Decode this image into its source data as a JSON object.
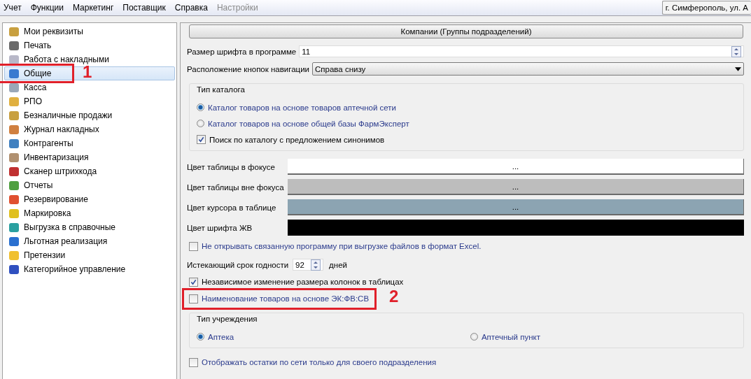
{
  "menu": [
    {
      "label": "Учет",
      "disabled": false
    },
    {
      "label": "Функции",
      "disabled": false
    },
    {
      "label": "Маркетинг",
      "disabled": false
    },
    {
      "label": "Поставщик",
      "disabled": false
    },
    {
      "label": "Справка",
      "disabled": false
    },
    {
      "label": "Настройки",
      "disabled": true
    }
  ],
  "location": {
    "value": "г. Симферополь, ул. А"
  },
  "sidebar": {
    "items": [
      {
        "label": "Мои реквизиты",
        "selected": false
      },
      {
        "label": "Печать",
        "selected": false
      },
      {
        "label": "Работа с накладными",
        "selected": false
      },
      {
        "label": "Общие",
        "selected": true,
        "callout": "1"
      },
      {
        "label": "Касса",
        "selected": false
      },
      {
        "label": "РПО",
        "selected": false
      },
      {
        "label": "Безналичные продажи",
        "selected": false
      },
      {
        "label": "Журнал накладных",
        "selected": false
      },
      {
        "label": "Контрагенты",
        "selected": false
      },
      {
        "label": "Инвентаризация",
        "selected": false
      },
      {
        "label": "Сканер штрихкода",
        "selected": false
      },
      {
        "label": "Отчеты",
        "selected": false
      },
      {
        "label": "Резервирование",
        "selected": false
      },
      {
        "label": "Маркировка",
        "selected": false
      },
      {
        "label": "Выгрузка в справочные",
        "selected": false
      },
      {
        "label": "Льготная реализация",
        "selected": false
      },
      {
        "label": "Претензии",
        "selected": false
      },
      {
        "label": "Категорийное управление",
        "selected": false
      }
    ]
  },
  "settings": [
    {
      "kind": "button",
      "label": "Компании (Группы подразделений)"
    },
    {
      "kind": "spin",
      "label": "Размер шрифта в программе",
      "value": "11"
    },
    {
      "kind": "dropdown",
      "label": "Расположение кнопок навигации",
      "value": "Справа снизу"
    },
    {
      "kind": "group",
      "title": "Тип каталога",
      "options": [
        {
          "kind": "radio",
          "label": "Каталог товаров на основе товаров аптечной сети",
          "selected": true,
          "highlighted": true
        },
        {
          "kind": "radio",
          "label": "Каталог товаров на основе общей базы ФармЭксперт",
          "selected": false,
          "highlighted": true
        },
        {
          "kind": "checkbox",
          "label": "Поиск по каталогу с предложением синонимов",
          "checked": true,
          "highlighted": false
        }
      ]
    },
    {
      "kind": "color",
      "label": "Цвет таблицы в фокусе",
      "color": "#ffffff",
      "button": "..."
    },
    {
      "kind": "color",
      "label": "Цвет таблицы вне фокуса",
      "color": "#bdbdbd",
      "button": "..."
    },
    {
      "kind": "color",
      "label": "Цвет курсора в таблице",
      "color": "#8ca4b2",
      "button": "..."
    },
    {
      "kind": "color",
      "label": "Цвет шрифта ЖВ",
      "color": "#000000"
    },
    {
      "kind": "checkbox",
      "label": "Не открывать связанную программу при выгрузке файлов в формат Excel.",
      "checked": false,
      "highlighted": true
    },
    {
      "kind": "number",
      "label": "Истекающий срок годности",
      "value": "92",
      "unit": "дней"
    },
    {
      "kind": "checkbox",
      "label": "Независимое изменение размера колонок в таблицах",
      "checked": true,
      "highlighted": false
    },
    {
      "kind": "checkbox",
      "label": "Наименование товаров на основе ЭК:ФВ:СВ",
      "checked": false,
      "highlighted": true,
      "callout": "2"
    },
    {
      "kind": "group",
      "title": "Тип учреждения",
      "options": [
        {
          "kind": "radio",
          "label": "Аптека",
          "selected": true,
          "highlighted": true
        },
        {
          "kind": "radio",
          "label": "Аптечный пункт",
          "selected": false,
          "highlighted": true
        }
      ]
    },
    {
      "kind": "checkbox",
      "label": "Отображать остатки по сети только для своего подразделения",
      "checked": false,
      "highlighted": true
    }
  ]
}
